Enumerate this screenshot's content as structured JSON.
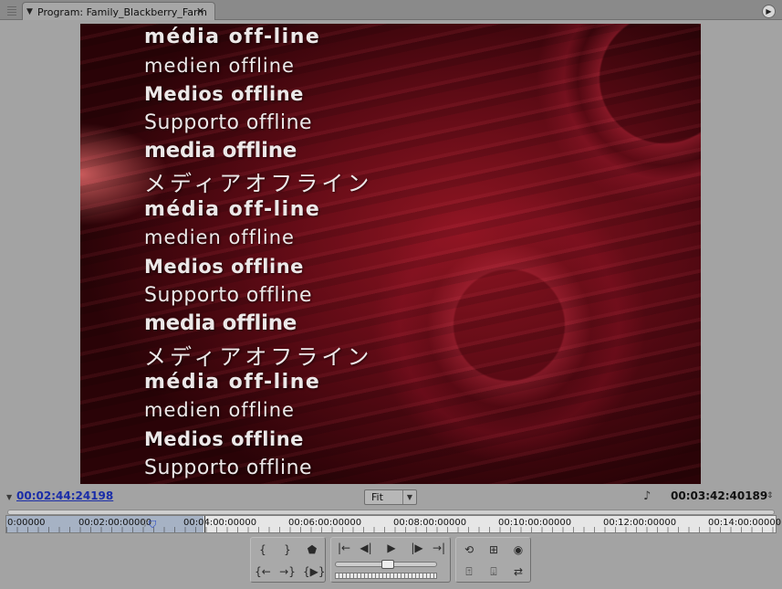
{
  "window": {
    "tab_title": "Program: Family_Blackberry_Farm",
    "tab_menu_icon": "triangle-down-icon",
    "close_icon": "close-icon",
    "panel_menu_icon": "panel-menu-icon"
  },
  "monitor": {
    "offline_lines": [
      "média off-line",
      "medien offline",
      "Medios offline",
      "Supporto offline",
      "media offline",
      "メディアオフライン",
      "média off-line",
      "medien offline",
      "Medios offline",
      "Supporto offline",
      "media offline",
      "メディアオフライン",
      "média off-line",
      "medien offline",
      "Medios offline",
      "Supporto offline"
    ]
  },
  "info_bar": {
    "current_time": "00:02:44:24198",
    "zoom_level": "Fit",
    "duration": "00:03:42:40189"
  },
  "ruler": {
    "labels": [
      "0:00000",
      "00:02:00:00000",
      "00:04:00:00000",
      "00:06:00:00000",
      "00:08:00:00000",
      "00:10:00:00000",
      "00:12:00:00000",
      "00:14:00:00000"
    ]
  },
  "controls": {
    "mark_in_icon": "mark-in-icon",
    "mark_out_icon": "mark-out-icon",
    "set_marker_icon": "set-marker-icon",
    "go_to_in_icon": "go-to-in-icon",
    "go_to_out_icon": "go-to-out-icon",
    "play_in_to_out_icon": "play-in-to-out-icon",
    "prev_edit_icon": "prev-edit-icon",
    "step_back_icon": "step-back-icon",
    "play_icon": "play-icon",
    "step_forward_icon": "step-forward-icon",
    "next_edit_icon": "next-edit-icon",
    "loop_icon": "loop-icon",
    "safe_margins_icon": "safe-margins-icon",
    "output_icon": "output-icon",
    "lift_icon": "lift-icon",
    "extract_icon": "extract-icon",
    "trim_icon": "trim-icon"
  },
  "colors": {
    "timecode_link": "#1a2da8",
    "panel_bg": "#a3a3a3",
    "monitor_red": "#8b0c1d"
  }
}
